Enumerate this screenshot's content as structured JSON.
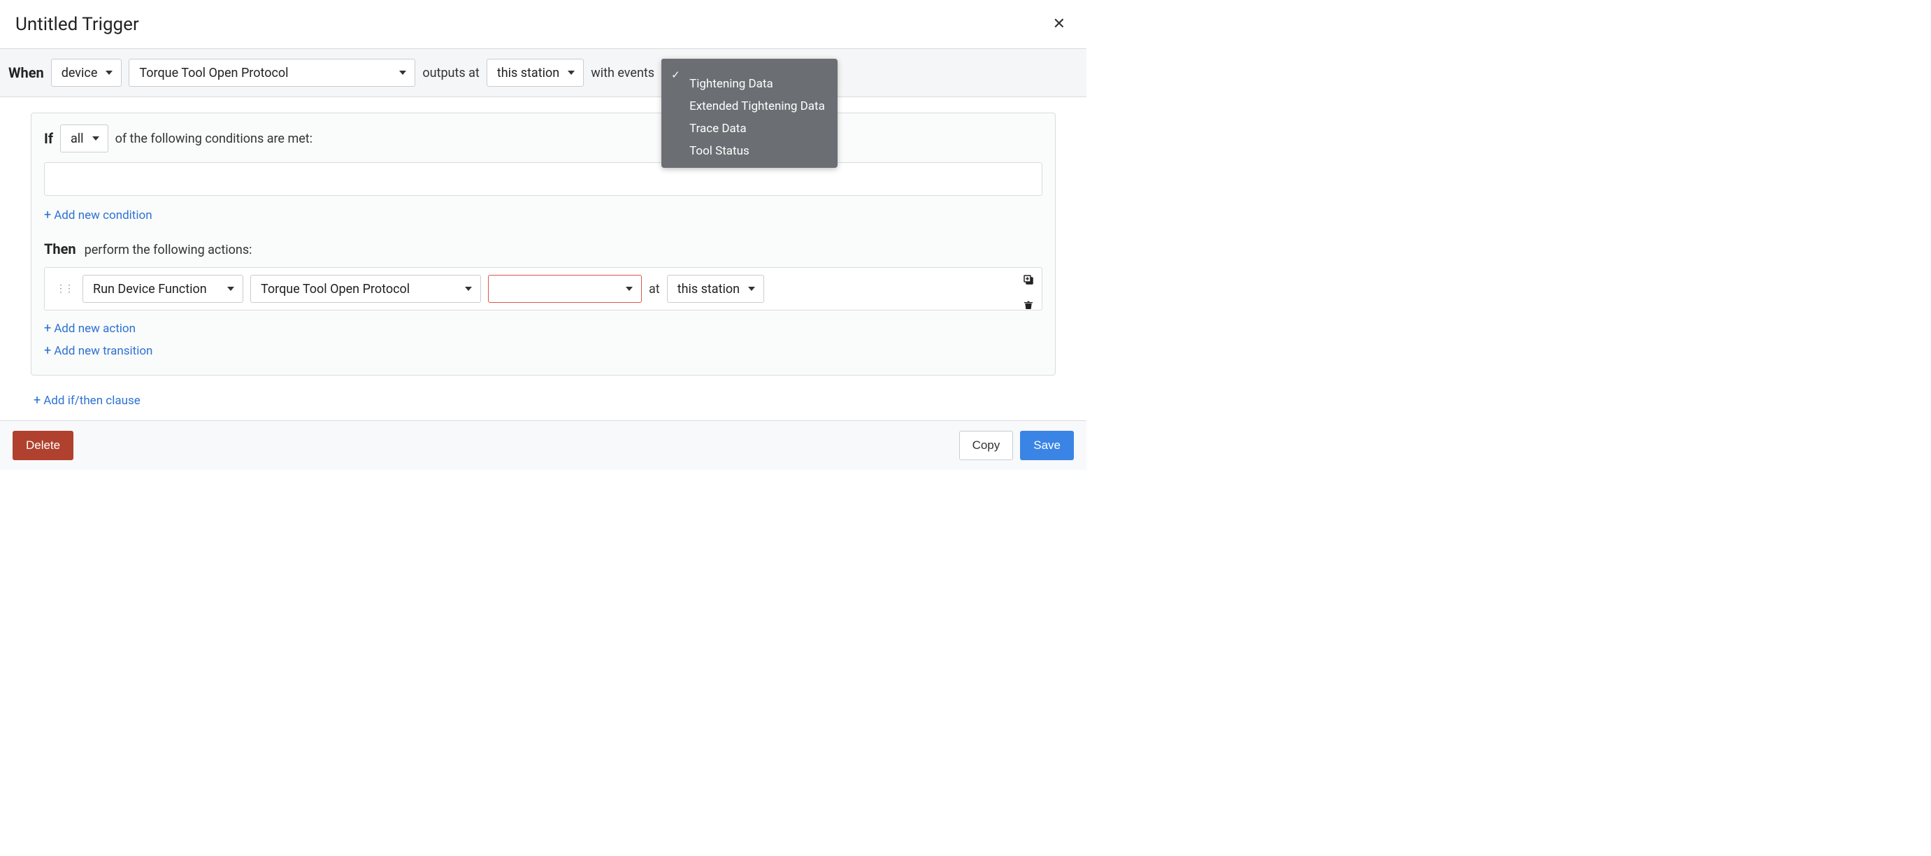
{
  "header": {
    "title": "Untitled Trigger"
  },
  "when": {
    "label": "When",
    "source_type": "device",
    "protocol": "Torque Tool Open Protocol",
    "outputs_label": "outputs at",
    "station": "this station",
    "events_label": "with events",
    "events_menu": {
      "selected": "",
      "options": [
        "Tightening Data",
        "Extended Tightening Data",
        "Trace Data",
        "Tool Status"
      ]
    }
  },
  "if": {
    "label": "If",
    "mode": "all",
    "suffix": "of the following conditions are met:",
    "add_condition": "Add new condition"
  },
  "then": {
    "label": "Then",
    "suffix": "perform the following actions:",
    "action": {
      "function": "Run Device Function",
      "protocol": "Torque Tool Open Protocol",
      "subfunction": "",
      "at_label": "at",
      "station": "this station"
    },
    "add_action": "Add new action",
    "add_transition": "Add new transition"
  },
  "add_clause": "Add if/then clause",
  "footer": {
    "delete": "Delete",
    "copy": "Copy",
    "save": "Save"
  }
}
